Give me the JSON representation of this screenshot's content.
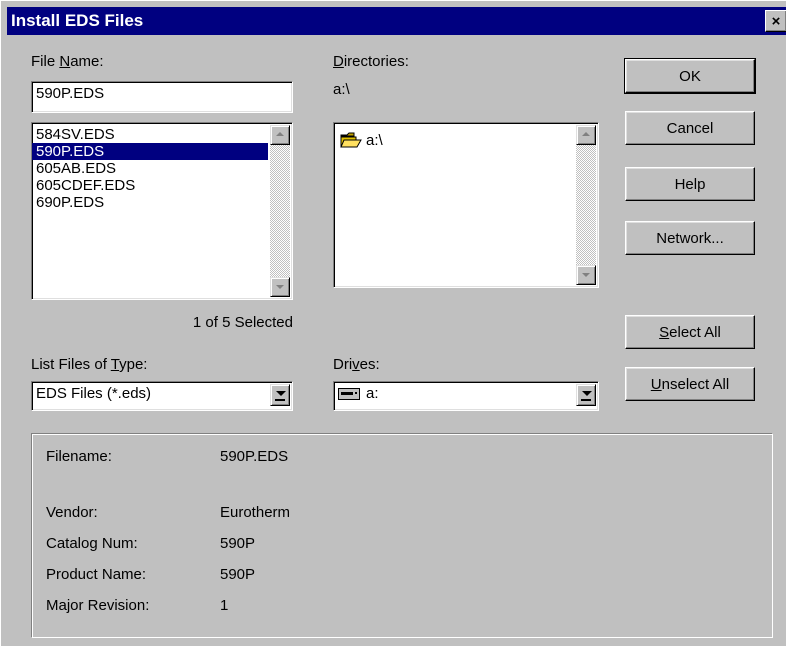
{
  "window": {
    "title": "Install EDS Files",
    "close_glyph": "×"
  },
  "file_name": {
    "label_pre": "File ",
    "label_accel": "N",
    "label_post": "ame:",
    "value": "590P.EDS",
    "items": [
      "584SV.EDS",
      "590P.EDS",
      "605AB.EDS",
      "605CDEF.EDS",
      "690P.EDS"
    ],
    "selected_index": 1,
    "selection_status": "1 of 5 Selected"
  },
  "directories": {
    "label_pre": "",
    "label_accel": "D",
    "label_post": "irectories:",
    "current": "a:\\",
    "items": [
      {
        "label": "a:\\",
        "icon": "open-folder-icon"
      }
    ]
  },
  "file_type": {
    "label_pre": "List Files of ",
    "label_accel": "T",
    "label_post": "ype:",
    "value": "EDS Files (*.eds)"
  },
  "drives": {
    "label_pre": "Dri",
    "label_accel": "v",
    "label_post": "es:",
    "value": "a:",
    "icon": "floppy-drive-icon"
  },
  "buttons": {
    "ok": "OK",
    "cancel": "Cancel",
    "help": "Help",
    "network": "Network...",
    "select_all_accel": "S",
    "select_all_rest": "elect All",
    "unselect_all_accel": "U",
    "unselect_all_rest": "nselect All"
  },
  "info": {
    "filename_label": "Filename:",
    "filename_value": "590P.EDS",
    "vendor_label": "Vendor:",
    "vendor_value": "Eurotherm",
    "catalog_label": "Catalog Num:",
    "catalog_value": "590P",
    "product_label": "Product Name:",
    "product_value": "590P",
    "revision_label": "Major Revision:",
    "revision_value": "1"
  },
  "colors": {
    "face": "#c0c0c0",
    "title": "#000080",
    "selection": "#000080"
  }
}
